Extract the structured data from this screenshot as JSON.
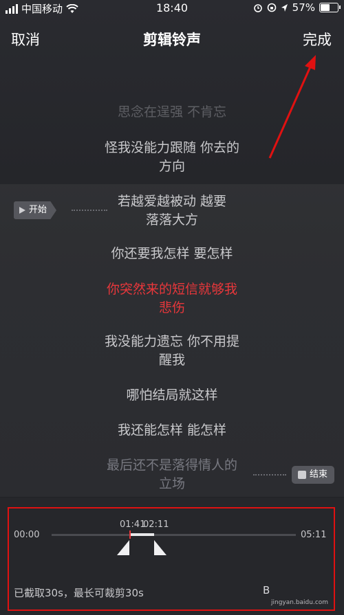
{
  "status_bar": {
    "carrier": "中国移动",
    "time": "18:40",
    "battery": "57%",
    "battery_level": 0.57
  },
  "nav": {
    "cancel": "取消",
    "title": "剪辑铃声",
    "done": "完成"
  },
  "lyrics": [
    {
      "text": "思念在逞强 不肯忘"
    },
    {
      "text": "怪我没能力跟随 你去的"
    },
    {
      "text": "方向"
    },
    {
      "text": "若越爱越被动 越要"
    },
    {
      "text": "落落大方"
    },
    {
      "text": "你还要我怎样 要怎样"
    },
    {
      "text": "你突然来的短信就够我"
    },
    {
      "text": "悲伤"
    },
    {
      "text": "我没能力遗忘 你不用提"
    },
    {
      "text": "醒我"
    },
    {
      "text": "哪怕结局就这样"
    },
    {
      "text": "我还能怎样 能怎样"
    },
    {
      "text": "最后还不是落得情人的"
    },
    {
      "text": "立场"
    }
  ],
  "markers": {
    "start": "开始",
    "end": "结束"
  },
  "timeline": {
    "start_time": "00:00",
    "end_time": "05:11",
    "selection_start": "01:41",
    "selection_end": "02:11"
  },
  "info_text": "已截取30s，最长可裁剪30s",
  "watermark": {
    "main": "B",
    "sub": "jingyan.baidu.com"
  },
  "colors": {
    "accent": "#e8373b",
    "annotation": "#e01111"
  }
}
